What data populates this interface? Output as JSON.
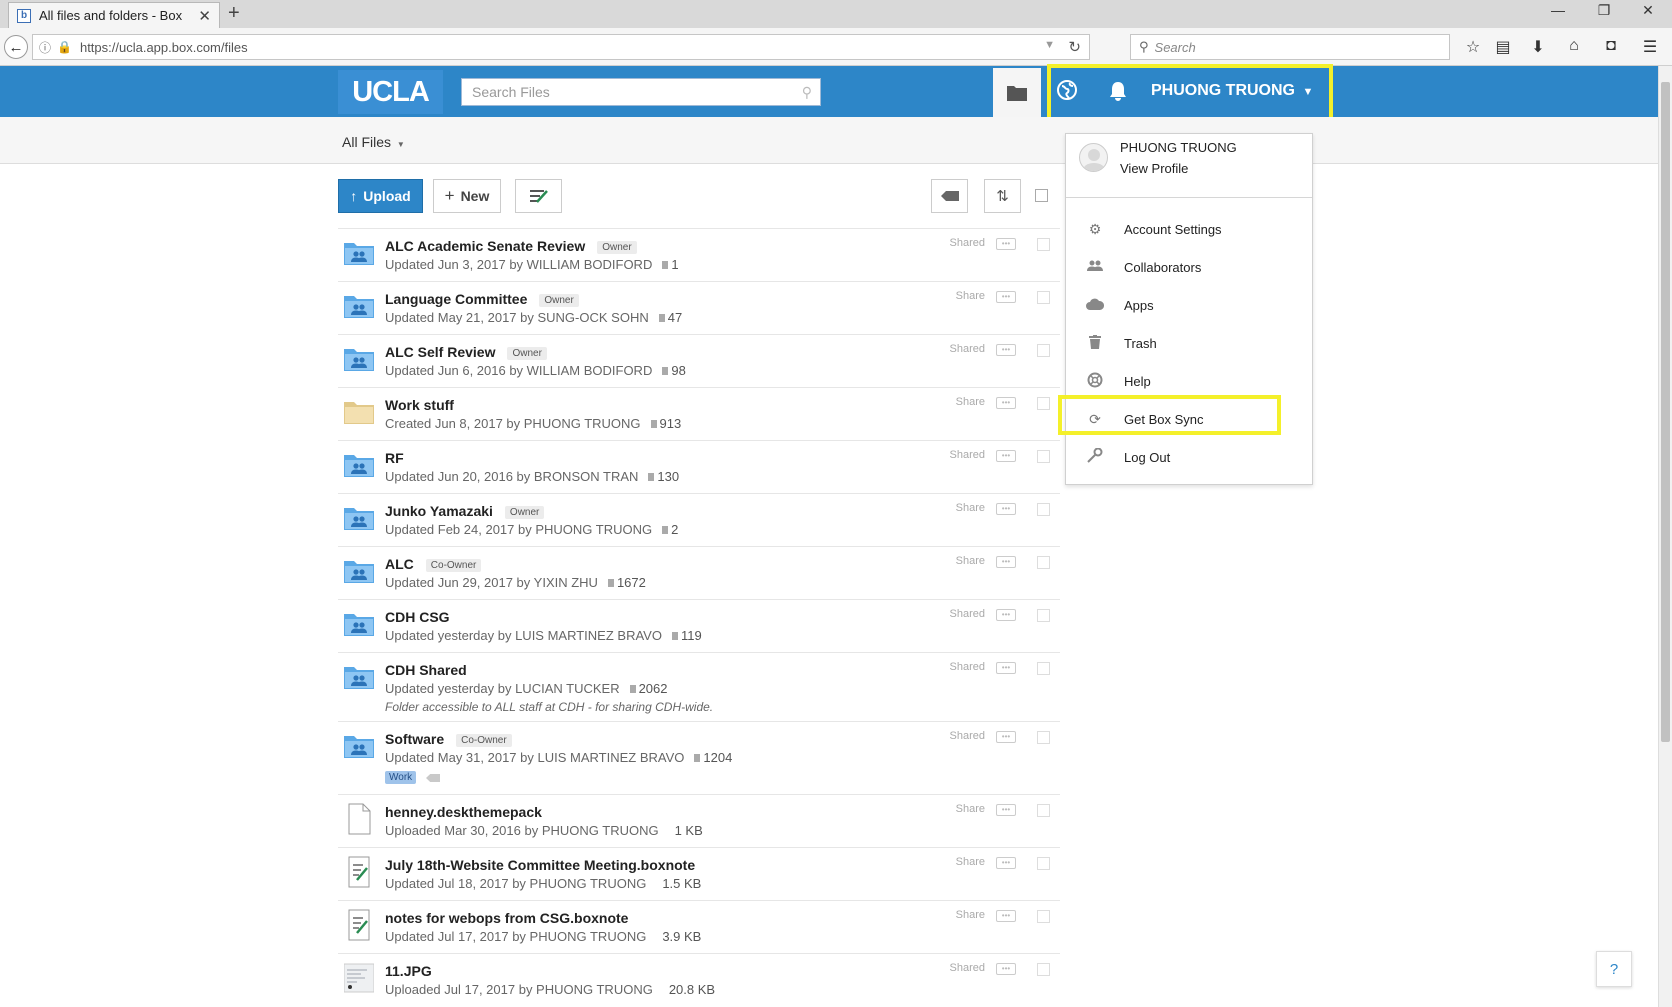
{
  "browser": {
    "tab_title": "All files and folders - Box",
    "favicon_letter": "b",
    "url": "https://ucla.app.box.com/files",
    "search_placeholder": "Search"
  },
  "header": {
    "logo": "UCLA",
    "search_placeholder": "Search Files",
    "user_name": "PHUONG TRUONG",
    "accent_color": "#2d86c8",
    "highlight_color": "#f4f02a"
  },
  "subbar": {
    "all_files": "All Files"
  },
  "toolbar": {
    "upload": "Upload",
    "new": "New"
  },
  "files": [
    {
      "name": "ALC Academic Senate Review",
      "badge": "Owner",
      "meta": "Updated Jun 3, 2017 by WILLIAM BODIFORD",
      "count": "1",
      "share": "Shared",
      "icon": "shared-folder-icon"
    },
    {
      "name": "Language Committee",
      "badge": "Owner",
      "meta": "Updated May 21, 2017 by SUNG-OCK SOHN",
      "count": "47",
      "share": "Share",
      "icon": "shared-folder-icon"
    },
    {
      "name": "ALC Self Review",
      "badge": "Owner",
      "meta": "Updated Jun 6, 2016 by WILLIAM BODIFORD",
      "count": "98",
      "share": "Shared",
      "icon": "shared-folder-icon"
    },
    {
      "name": "Work stuff",
      "badge": "",
      "meta": "Created Jun 8, 2017 by PHUONG TRUONG",
      "count": "913",
      "share": "Share",
      "icon": "personal-folder-icon"
    },
    {
      "name": "RF",
      "badge": "",
      "meta": "Updated Jun 20, 2016 by BRONSON TRAN",
      "count": "130",
      "share": "Shared",
      "icon": "shared-folder-icon"
    },
    {
      "name": "Junko Yamazaki",
      "badge": "Owner",
      "meta": "Updated Feb 24, 2017 by PHUONG TRUONG",
      "count": "2",
      "share": "Share",
      "icon": "shared-folder-icon"
    },
    {
      "name": "ALC",
      "badge": "Co-Owner",
      "meta": "Updated Jun 29, 2017 by YIXIN ZHU",
      "count": "1672",
      "share": "Share",
      "icon": "shared-folder-icon"
    },
    {
      "name": "CDH CSG",
      "badge": "",
      "meta": "Updated yesterday by LUIS MARTINEZ BRAVO",
      "count": "119",
      "share": "Shared",
      "icon": "shared-folder-icon"
    },
    {
      "name": "CDH Shared",
      "badge": "",
      "meta": "Updated yesterday by LUCIAN TUCKER",
      "count": "2062",
      "share": "Shared",
      "icon": "shared-folder-icon",
      "description": "Folder accessible to ALL staff at CDH - for sharing CDH-wide."
    },
    {
      "name": "Software",
      "badge": "Co-Owner",
      "meta": "Updated May 31, 2017 by LUIS MARTINEZ BRAVO",
      "count": "1204",
      "share": "Shared",
      "icon": "shared-folder-icon",
      "tag": "Work"
    },
    {
      "name": "henney.deskthemepack",
      "badge": "",
      "meta": "Uploaded Mar 30, 2016 by PHUONG TRUONG",
      "size": "1 KB",
      "share": "Share",
      "icon": "file-icon"
    },
    {
      "name": "July 18th-Website Committee Meeting.boxnote",
      "badge": "",
      "meta": "Updated Jul 18, 2017 by PHUONG TRUONG",
      "size": "1.5 KB",
      "share": "Share",
      "icon": "boxnote-icon"
    },
    {
      "name": "notes for webops from CSG.boxnote",
      "badge": "",
      "meta": "Updated Jul 17, 2017 by PHUONG TRUONG",
      "size": "3.9 KB",
      "share": "Share",
      "icon": "boxnote-icon"
    },
    {
      "name": "11.JPG",
      "badge": "",
      "meta": "Uploaded Jul 17, 2017 by PHUONG TRUONG",
      "size": "20.8 KB",
      "share": "Shared",
      "icon": "image-thumbnail-icon"
    }
  ],
  "dropdown": {
    "name": "PHUONG TRUONG",
    "view_profile": "View Profile",
    "items": [
      {
        "label": "Account Settings",
        "icon": "gear-icon"
      },
      {
        "label": "Collaborators",
        "icon": "collaborators-icon"
      },
      {
        "label": "Apps",
        "icon": "cloud-icon"
      },
      {
        "label": "Trash",
        "icon": "trash-icon"
      },
      {
        "label": "Help",
        "icon": "lifebuoy-icon"
      },
      {
        "label": "Get Box Sync",
        "icon": "sync-icon"
      },
      {
        "label": "Log Out",
        "icon": "key-icon"
      }
    ]
  },
  "help_button": "?"
}
